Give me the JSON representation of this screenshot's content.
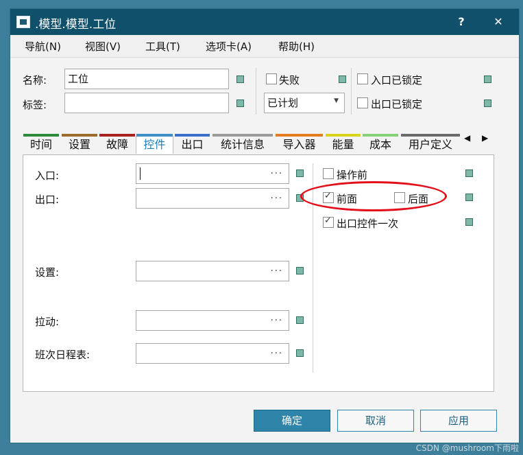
{
  "window": {
    "title": ".模型.模型.工位",
    "help_label": "?",
    "close_label": "✕"
  },
  "menu": [
    "导航(N)",
    "视图(V)",
    "工具(T)",
    "选项卡(A)",
    "帮助(H)"
  ],
  "header": {
    "name_label": "名称:",
    "name_value": "工位",
    "tag_label": "标签:",
    "tag_value": "",
    "failed_label": "失败",
    "failed_checked": false,
    "plan_value": "已计划",
    "entrance_locked_label": "入口已锁定",
    "entrance_locked_checked": false,
    "exit_locked_label": "出口已锁定",
    "exit_locked_checked": false
  },
  "tabs": [
    {
      "label": "时间",
      "color": "#2e8b3c",
      "active": false
    },
    {
      "label": "设置",
      "color": "#9a6b2b",
      "active": false
    },
    {
      "label": "故障",
      "color": "#a8201f",
      "active": false
    },
    {
      "label": "控件",
      "color": "#3f8ec7",
      "active": true
    },
    {
      "label": "出口",
      "color": "#3b6fc9",
      "active": false
    },
    {
      "label": "统计信息",
      "color": "#9a9a9a",
      "active": false
    },
    {
      "label": "导入器",
      "color": "#e37b1f",
      "active": false
    },
    {
      "label": "能量",
      "color": "#d8d41a",
      "active": false
    },
    {
      "label": "成本",
      "color": "#86d07a",
      "active": false
    },
    {
      "label": "用户定义",
      "color": "#6a6a6a",
      "active": false
    }
  ],
  "tab_scroll": {
    "left": "◀",
    "right": "▶"
  },
  "controls": {
    "entrance_label": "入口:",
    "entrance_value": "",
    "exit_label": "出口:",
    "exit_value": "",
    "setup_label": "设置:",
    "setup_value": "",
    "pull_label": "拉动:",
    "pull_value": "",
    "shift_label": "班次日程表:",
    "shift_value": "",
    "dots": "...",
    "before_operation_label": "操作前",
    "before_operation_checked": false,
    "front_label": "前面",
    "front_checked": true,
    "rear_label": "后面",
    "rear_checked": false,
    "exit_once_label": "出口控件一次",
    "exit_once_checked": true
  },
  "buttons": {
    "ok": "确定",
    "cancel": "取消",
    "apply": "应用"
  },
  "watermark": "CSDN @mushroom下雨啦"
}
